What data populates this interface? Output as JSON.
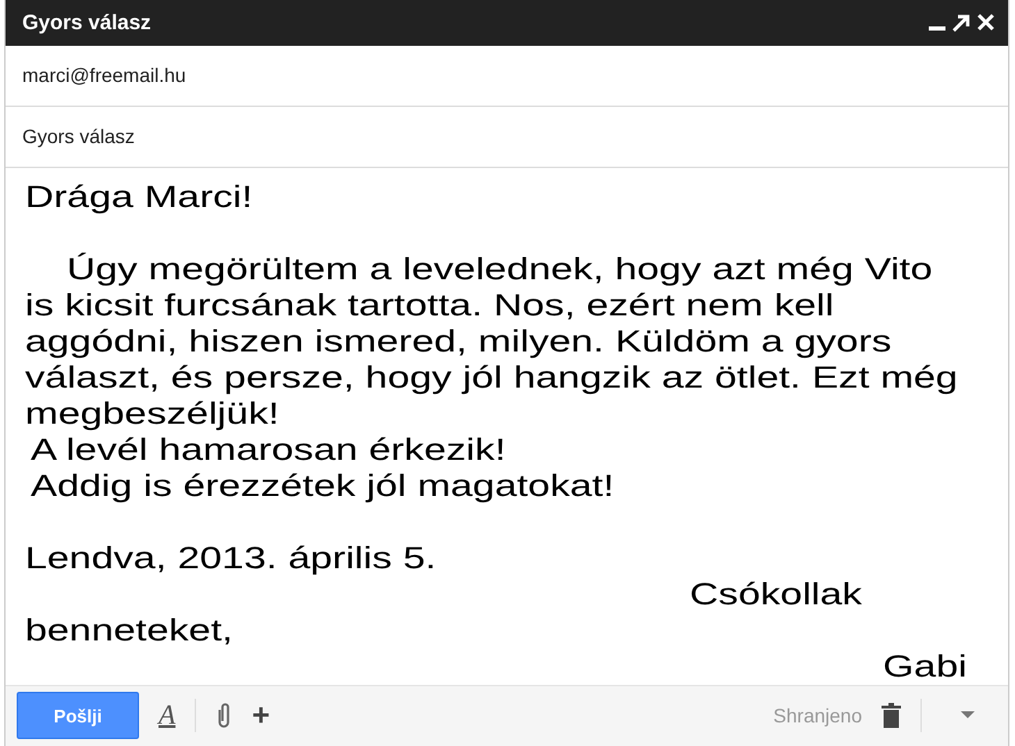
{
  "window": {
    "title": "Gyors válasz"
  },
  "to": {
    "value": "marci@freemail.hu"
  },
  "subject": {
    "value": "Gyors válasz"
  },
  "body": [
    {
      "lines": [
        {
          "text": "Drága Marci!",
          "kind": "plain"
        }
      ]
    },
    {
      "lines": [
        {
          "text": "Úgy megörültem a levelednek, hogy azt még Vito",
          "kind": "indent"
        },
        {
          "text": "is kicsit furcsának tartotta. Nos, ezért nem kell",
          "kind": "plain"
        },
        {
          "text": "aggódni, hiszen ismered, milyen. Küldöm a gyors",
          "kind": "plain"
        },
        {
          "text": "választ, és persze, hogy jól hangzik az ötlet. Ezt még",
          "kind": "plain"
        },
        {
          "text": "megbeszéljük!",
          "kind": "plain"
        },
        {
          "text": "A levél hamarosan érkezik!",
          "kind": "nudge"
        },
        {
          "text": "Addig is érezzétek jól magatokat!",
          "kind": "nudge"
        }
      ]
    },
    {
      "lines": [
        {
          "text": "Lendva, 2013. április 5.",
          "kind": "plain"
        },
        {
          "text": "Csókollak",
          "kind": "closing"
        },
        {
          "text": "benneteket,",
          "kind": "plain"
        },
        {
          "text": "Gabi",
          "kind": "right"
        }
      ]
    }
  ],
  "toolbar": {
    "send": "Pošlji",
    "format_glyph": "A",
    "more_glyph": "+",
    "status": "Shranjeno"
  }
}
